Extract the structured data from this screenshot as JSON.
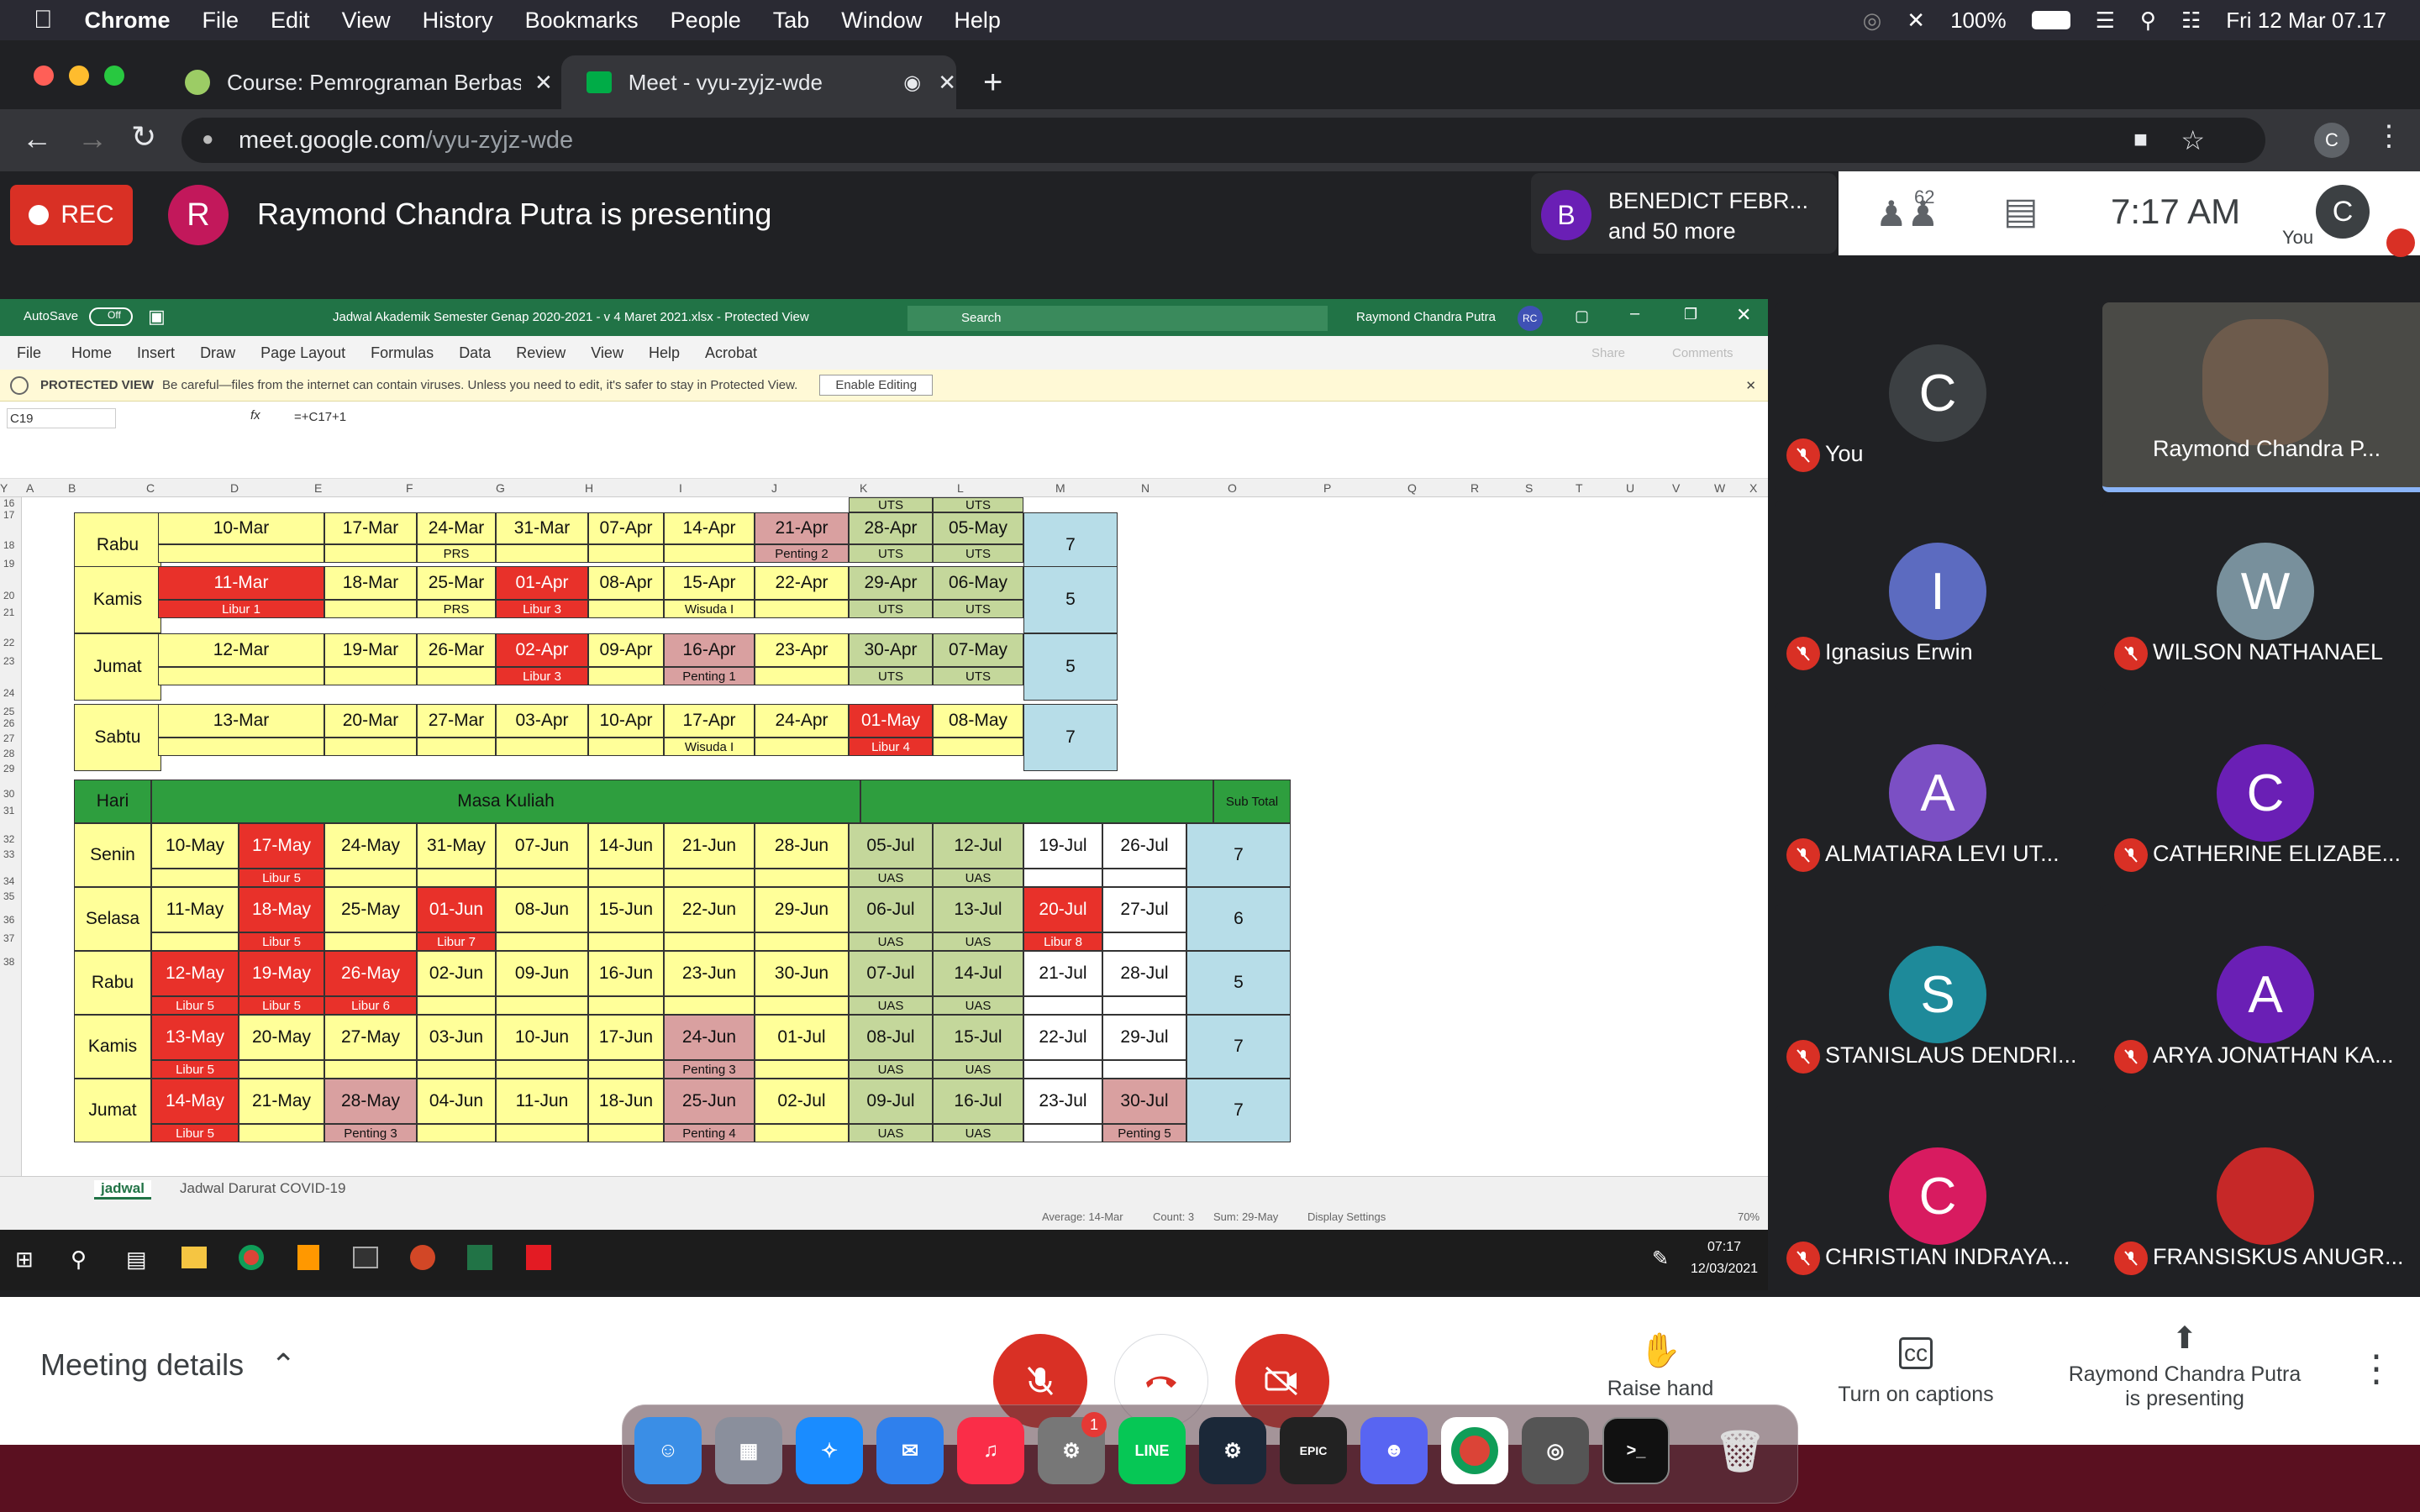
{
  "menubar": {
    "app": "Chrome",
    "items": [
      "File",
      "Edit",
      "View",
      "History",
      "Bookmarks",
      "People",
      "Tab",
      "Window",
      "Help"
    ],
    "battery": "100%",
    "datetime": "Fri 12 Mar  07.17"
  },
  "browser": {
    "tabs": [
      {
        "title": "Course: Pemrograman Berbasi"
      },
      {
        "title": "Meet - vyu-zyjz-wde"
      }
    ],
    "url_host": "meet.google.com",
    "url_path": "/vyu-zyjz-wde",
    "profile_initial": "C"
  },
  "meet": {
    "rec_label": "REC",
    "presenter_initial": "R",
    "presenter_text": "Raymond Chandra Putra is presenting",
    "speaker_initial": "B",
    "speaker_name": "BENEDICT FEBR...",
    "speaker_more": "and 50 more",
    "participant_count": "62",
    "time": "7:17 AM",
    "self_label": "You",
    "self_initial": "C",
    "tiles": [
      {
        "name": "You",
        "initial": "C",
        "color": "#3c4043"
      },
      {
        "name": "Raymond Chandra P...",
        "initial": "",
        "color": "#3c4043"
      },
      {
        "name": "Ignasius Erwin",
        "initial": "I",
        "color": "#5c6bc0"
      },
      {
        "name": "WILSON NATHANAEL",
        "initial": "W",
        "color": "#78909c"
      },
      {
        "name": "ALMATIARA LEVI UT...",
        "initial": "A",
        "color": "#7b4fc4"
      },
      {
        "name": "CATHERINE ELIZABE...",
        "initial": "C",
        "color": "#6a1fb5"
      },
      {
        "name": "STANISLAUS DENDRI...",
        "initial": "S",
        "color": "#1e8a9a"
      },
      {
        "name": "ARYA JONATHAN KA...",
        "initial": "A",
        "color": "#6a1fb5"
      },
      {
        "name": "CHRISTIAN INDRAYA...",
        "initial": "C",
        "color": "#d81b60"
      },
      {
        "name": "FRANSISKUS ANUGR...",
        "initial": "",
        "color": "#c62828"
      }
    ],
    "bottom": {
      "meeting_details": "Meeting details",
      "raise_hand": "Raise hand",
      "captions": "Turn on captions",
      "presenting_1": "Raymond Chandra Putra",
      "presenting_2": "is presenting"
    }
  },
  "excel": {
    "autosave": "AutoSave",
    "autosave_state": "Off",
    "file_title": "Jadwal Akademik Semester Genap 2020-2021 - v 4 Maret 2021.xlsx  -  Protected View",
    "search": "Search",
    "user": "Raymond Chandra Putra",
    "user_initials": "RC",
    "ribbon": [
      "File",
      "Home",
      "Insert",
      "Draw",
      "Page Layout",
      "Formulas",
      "Data",
      "Review",
      "View",
      "Help",
      "Acrobat"
    ],
    "share": "Share",
    "comments": "Comments",
    "protected_label": "PROTECTED VIEW",
    "protected_msg": "Be careful—files from the internet can contain viruses. Unless you need to edit, it's safer to stay in Protected View.",
    "enable_editing": "Enable Editing",
    "name_box": "C19",
    "formula": "=+C17+1",
    "columns": [
      "A",
      "B",
      "C",
      "D",
      "E",
      "F",
      "G",
      "H",
      "I",
      "J",
      "K",
      "L",
      "M",
      "N",
      "O",
      "P",
      "Q",
      "R",
      "S",
      "T",
      "U",
      "V",
      "W",
      "X",
      "Y"
    ],
    "rows": [
      "16",
      "17",
      "18",
      "19",
      "20",
      "21",
      "22",
      "23",
      "24",
      "25",
      "26",
      "27",
      "28",
      "29",
      "30",
      "31",
      "32",
      "33",
      "34",
      "35",
      "36",
      "37",
      "38"
    ],
    "table1": [
      {
        "day": "Rabu",
        "dates": [
          "10-Mar",
          "17-Mar",
          "24-Mar",
          "31-Mar",
          "07-Apr",
          "14-Apr",
          "21-Apr",
          "28-Apr",
          "05-May"
        ],
        "top": [
          "",
          "",
          "",
          "",
          "",
          "",
          "",
          "UTS",
          "UTS"
        ],
        "notes": [
          "",
          "",
          "PRS",
          "",
          "",
          "",
          "Penting 2",
          "UTS",
          "UTS"
        ],
        "total": "7"
      },
      {
        "day": "Kamis",
        "dates": [
          "11-Mar",
          "18-Mar",
          "25-Mar",
          "01-Apr",
          "08-Apr",
          "15-Apr",
          "22-Apr",
          "29-Apr",
          "06-May"
        ],
        "notes": [
          "Libur 1",
          "",
          "PRS",
          "Libur 3",
          "",
          "Wisuda I",
          "",
          "UTS",
          "UTS"
        ],
        "total": "5"
      },
      {
        "day": "Jumat",
        "dates": [
          "12-Mar",
          "19-Mar",
          "26-Mar",
          "02-Apr",
          "09-Apr",
          "16-Apr",
          "23-Apr",
          "30-Apr",
          "07-May"
        ],
        "notes": [
          "",
          "",
          "",
          "Libur 3",
          "",
          "Penting 1",
          "",
          "UTS",
          "UTS"
        ],
        "total": "5"
      },
      {
        "day": "Sabtu",
        "dates": [
          "13-Mar",
          "20-Mar",
          "27-Mar",
          "03-Apr",
          "10-Apr",
          "17-Apr",
          "24-Apr",
          "01-May",
          "08-May"
        ],
        "notes": [
          "",
          "",
          "",
          "",
          "",
          "Wisuda I",
          "",
          "Libur 4",
          ""
        ],
        "total": "7"
      }
    ],
    "table2_header": {
      "hari": "Hari",
      "masa": "Masa Kuliah",
      "sub": "Sub Total"
    },
    "table2": [
      {
        "day": "Senin",
        "dates": [
          "10-May",
          "17-May",
          "24-May",
          "31-May",
          "07-Jun",
          "14-Jun",
          "21-Jun",
          "28-Jun",
          "05-Jul",
          "12-Jul",
          "19-Jul",
          "26-Jul"
        ],
        "notes": [
          "",
          "Libur 5",
          "",
          "",
          "",
          "",
          "",
          "",
          "UAS",
          "UAS",
          "",
          ""
        ],
        "total": "7"
      },
      {
        "day": "Selasa",
        "dates": [
          "11-May",
          "18-May",
          "25-May",
          "01-Jun",
          "08-Jun",
          "15-Jun",
          "22-Jun",
          "29-Jun",
          "06-Jul",
          "13-Jul",
          "20-Jul",
          "27-Jul"
        ],
        "notes": [
          "",
          "Libur 5",
          "",
          "Libur 7",
          "",
          "",
          "",
          "",
          "UAS",
          "UAS",
          "Libur 8",
          ""
        ],
        "total": "6"
      },
      {
        "day": "Rabu",
        "dates": [
          "12-May",
          "19-May",
          "26-May",
          "02-Jun",
          "09-Jun",
          "16-Jun",
          "23-Jun",
          "30-Jun",
          "07-Jul",
          "14-Jul",
          "21-Jul",
          "28-Jul"
        ],
        "notes": [
          "Libur 5",
          "Libur 5",
          "Libur 6",
          "",
          "",
          "",
          "",
          "",
          "UAS",
          "UAS",
          "",
          ""
        ],
        "total": "5"
      },
      {
        "day": "Kamis",
        "dates": [
          "13-May",
          "20-May",
          "27-May",
          "03-Jun",
          "10-Jun",
          "17-Jun",
          "24-Jun",
          "01-Jul",
          "08-Jul",
          "15-Jul",
          "22-Jul",
          "29-Jul"
        ],
        "notes": [
          "Libur 5",
          "",
          "",
          "",
          "",
          "",
          "Penting 3",
          "",
          "UAS",
          "UAS",
          "",
          ""
        ],
        "total": "7"
      },
      {
        "day": "Jumat",
        "dates": [
          "14-May",
          "21-May",
          "28-May",
          "04-Jun",
          "11-Jun",
          "18-Jun",
          "25-Jun",
          "02-Jul",
          "09-Jul",
          "16-Jul",
          "23-Jul",
          "30-Jul"
        ],
        "notes": [
          "Libur 5",
          "",
          "Penting 3",
          "",
          "",
          "",
          "Penting 4",
          "",
          "UAS",
          "UAS",
          "",
          "Penting 5"
        ],
        "total": "7"
      }
    ],
    "sheets": [
      "jadwal",
      "Jadwal Darurat COVID-19"
    ],
    "status": {
      "average": "Average: 14-Mar",
      "count": "Count: 3",
      "sum": "Sum: 29-May",
      "display": "Display Settings",
      "zoom": "70%"
    },
    "taskbar_time": "07:17",
    "taskbar_date": "12/03/2021"
  },
  "dock": {
    "settings_badge": "1"
  },
  "colors": {
    "meet_red": "#d93025",
    "excel_green": "#217346",
    "cell_yellow": "#ffff99",
    "cell_red": "#e8312a",
    "cell_pink": "#d9a0a0",
    "cell_olive": "#c4d79b",
    "cell_blue": "#b7dde8"
  }
}
